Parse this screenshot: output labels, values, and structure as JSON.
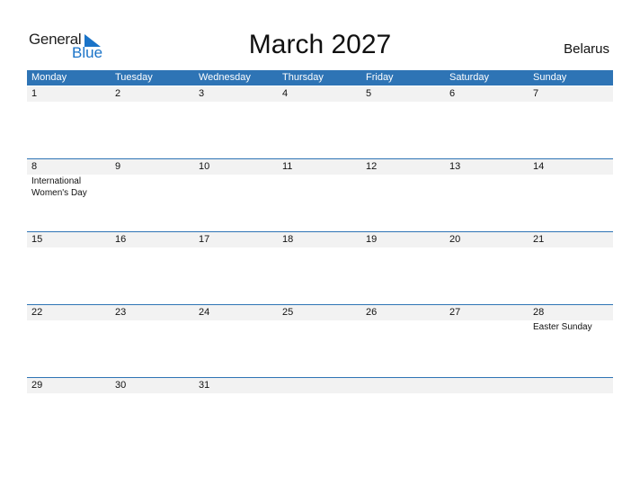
{
  "logo": {
    "word1": "General",
    "word2": "Blue"
  },
  "title": "March 2027",
  "country": "Belarus",
  "colors": {
    "accent": "#2e74b5",
    "strip": "#f2f2f2"
  },
  "weekdays": [
    "Monday",
    "Tuesday",
    "Wednesday",
    "Thursday",
    "Friday",
    "Saturday",
    "Sunday"
  ],
  "weeks": [
    {
      "days": [
        "1",
        "2",
        "3",
        "4",
        "5",
        "6",
        "7"
      ],
      "holidays": [
        "",
        "",
        "",
        "",
        "",
        "",
        ""
      ]
    },
    {
      "days": [
        "8",
        "9",
        "10",
        "11",
        "12",
        "13",
        "14"
      ],
      "holidays": [
        "International Women's Day",
        "",
        "",
        "",
        "",
        "",
        ""
      ]
    },
    {
      "days": [
        "15",
        "16",
        "17",
        "18",
        "19",
        "20",
        "21"
      ],
      "holidays": [
        "",
        "",
        "",
        "",
        "",
        "",
        ""
      ]
    },
    {
      "days": [
        "22",
        "23",
        "24",
        "25",
        "26",
        "27",
        "28"
      ],
      "holidays": [
        "",
        "",
        "",
        "",
        "",
        "",
        "Easter Sunday"
      ]
    },
    {
      "days": [
        "29",
        "30",
        "31",
        "",
        "",
        "",
        ""
      ],
      "holidays": [
        "",
        "",
        "",
        "",
        "",
        "",
        ""
      ]
    }
  ]
}
